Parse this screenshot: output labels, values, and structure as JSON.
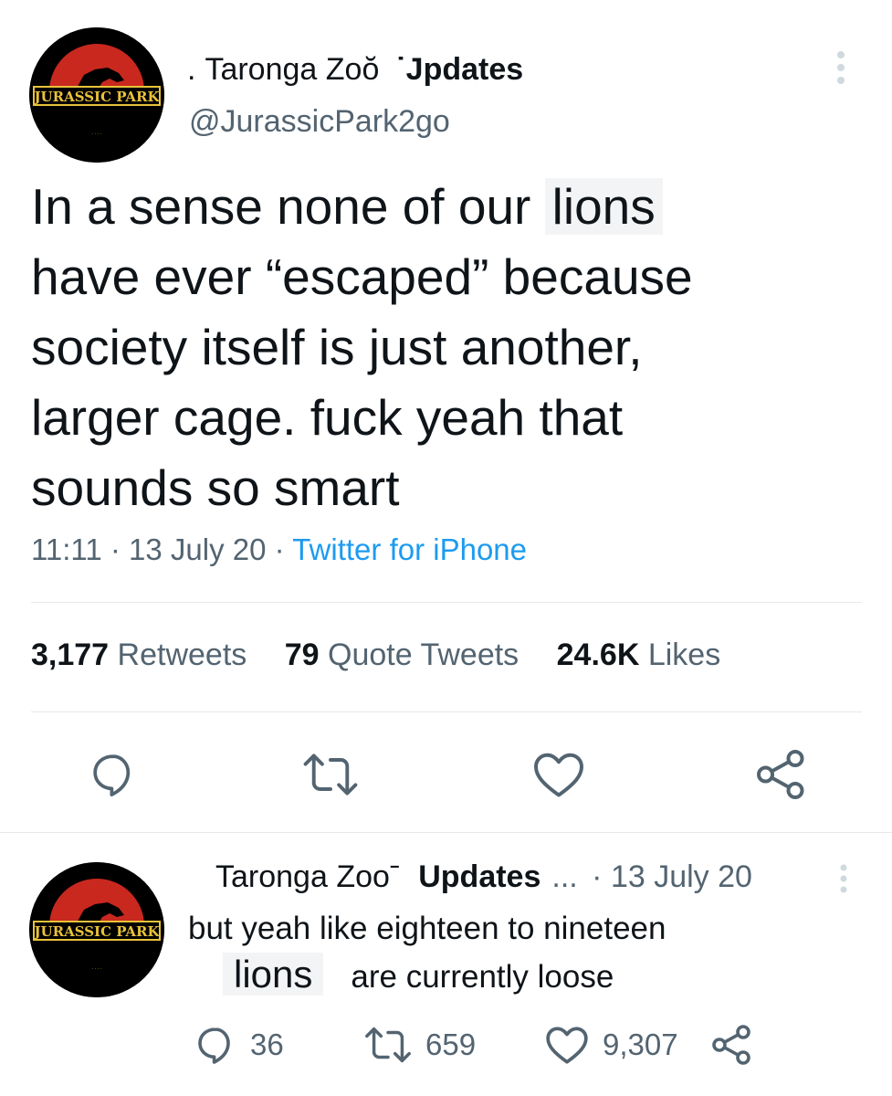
{
  "tweet": {
    "avatar_logo_text": "JURASSIC PARK",
    "name_prefix": ".",
    "name_part1": "Taronga Zoŏ",
    "name_part2": "˙Jpdates",
    "handle": "@JurassicPark2go",
    "text_lines": [
      "In a sense none of our ",
      "have ever “escaped” because",
      "society itself is just another,",
      "larger cage. fuck yeah that",
      "sounds so smart"
    ],
    "text_highlight": "lions",
    "time": "11:11",
    "date": "13 July 20",
    "source": "Twitter for iPhone",
    "sep": "·",
    "stats": {
      "retweets_count": "3,177",
      "retweets_label": "Retweets",
      "quotes_count": "79",
      "quotes_label": "Quote Tweets",
      "likes_count": "24.6K",
      "likes_label": "Likes"
    },
    "actions": [
      "reply-icon",
      "retweet-icon",
      "like-icon",
      "share-icon"
    ]
  },
  "reply": {
    "avatar_logo_text": "JURASSIC PARK",
    "name_part1": "Taronga Zooˉ",
    "name_part2": "Updates",
    "ellipsis": "...",
    "date": "· 13 July 20",
    "line1": "but yeah like eighteen to nineteen",
    "lions": "lions",
    "line2_rest": "are currently loose",
    "reply_count": "36",
    "retweet_count": "659",
    "like_count": "9,307"
  },
  "colors": {
    "text": "#0f1419",
    "secondary": "#536471",
    "link": "#1d9bf0",
    "divider": "#e6e9eb",
    "logo_red": "#c8281e"
  }
}
